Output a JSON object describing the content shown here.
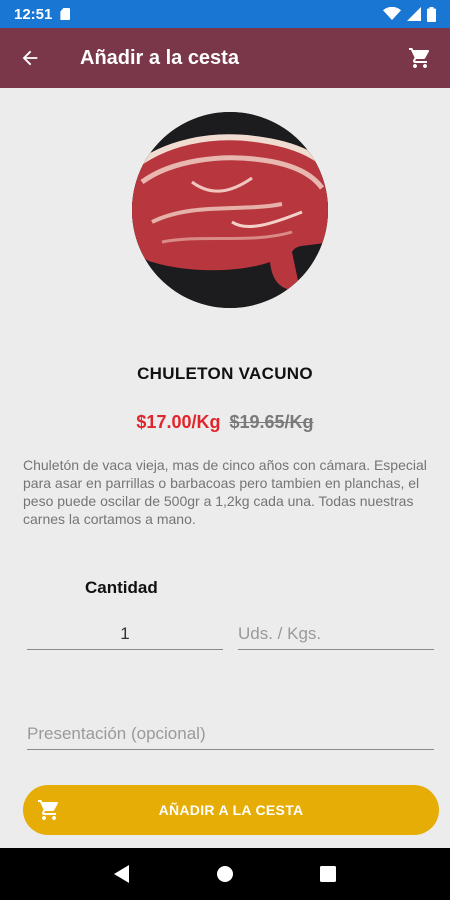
{
  "status_bar": {
    "time": "12:51"
  },
  "app_bar": {
    "title": "Añadir a la cesta",
    "back_icon": "arrow-back-icon",
    "cart_icon": "shopping-cart-icon"
  },
  "product": {
    "name": "CHULETON VACUNO",
    "price": "$17.00/Kg",
    "old_price": "$19.65/Kg",
    "description": "Chuletón de vaca vieja, mas de cinco años con cámara. Especial para asar en parrillas o barbacoas pero tambien en planchas, el peso puede oscilar de 500gr a 1,2kg cada una. Todas nuestras carnes la cortamos a mano."
  },
  "form": {
    "quantity_label": "Cantidad",
    "quantity_value": "1",
    "unit_placeholder": "Uds. / Kgs.",
    "presentation_placeholder": "Presentación (opcional)"
  },
  "actions": {
    "add_label": "AÑADIR A LA CESTA"
  },
  "colors": {
    "status_bar": "#1976d2",
    "app_bar": "#7a3749",
    "accent_button": "#e5ad06",
    "price_new": "#e0252b"
  }
}
